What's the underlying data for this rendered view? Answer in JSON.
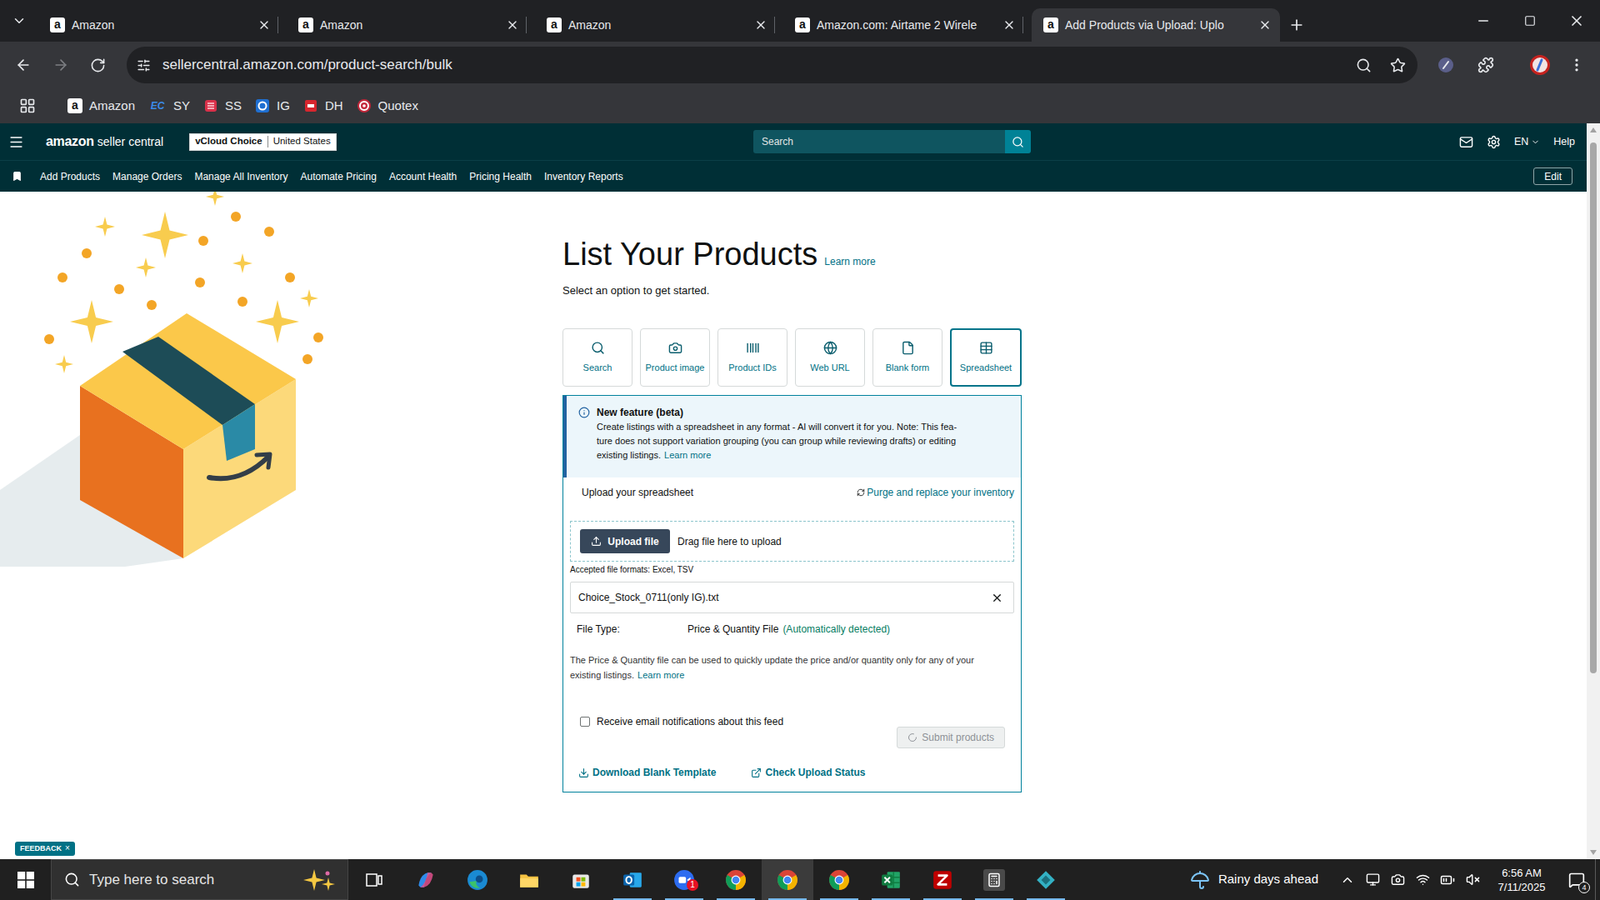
{
  "browser": {
    "tabs": [
      {
        "favicon": "a",
        "label": "Amazon",
        "selected": false
      },
      {
        "favicon": "a",
        "label": "Amazon",
        "selected": false
      },
      {
        "favicon": "a",
        "label": "Amazon",
        "selected": false
      },
      {
        "favicon": "a",
        "label": "Amazon.com: Airtame 2 Wirele",
        "selected": false
      },
      {
        "favicon": "a",
        "label": "Add Products via Upload: Uplo",
        "selected": true
      }
    ],
    "back_enabled": true,
    "forward_enabled": false,
    "url": "sellercentral.amazon.com/product-search/bulk",
    "bookmarks": [
      {
        "label": "Amazon",
        "kind": "amazon",
        "icon_text": "a"
      },
      {
        "label": "SY",
        "kind": "ec",
        "icon_text": "EC"
      },
      {
        "label": "SS",
        "kind": "ss"
      },
      {
        "label": "IG",
        "kind": "ig"
      },
      {
        "label": "DH",
        "kind": "dh"
      },
      {
        "label": "Quotex",
        "kind": "quotex"
      }
    ]
  },
  "header": {
    "brand": "amazon",
    "product": "seller central",
    "store": "vCloud Choice",
    "marketplace": "United States",
    "search_placeholder": "Search",
    "language": "EN",
    "help": "Help"
  },
  "nav": {
    "items": [
      "Add Products",
      "Manage Orders",
      "Manage All Inventory",
      "Automate Pricing",
      "Account Health",
      "Pricing Health",
      "Inventory Reports"
    ],
    "edit": "Edit"
  },
  "page": {
    "title": "List Your Products",
    "title_link": "Learn more",
    "subtitle": "Select an option to get started.",
    "options": [
      {
        "label": "Search",
        "kind": "search",
        "selected": false
      },
      {
        "label": "Product image",
        "kind": "image",
        "selected": false
      },
      {
        "label": "Product IDs",
        "kind": "ids",
        "selected": false
      },
      {
        "label": "Web URL",
        "kind": "url",
        "selected": false
      },
      {
        "label": "Blank form",
        "kind": "form",
        "selected": false
      },
      {
        "label": "Spreadsheet",
        "kind": "spreadsheet",
        "selected": true
      }
    ],
    "info": {
      "title": "New feature (beta)",
      "lines": [
        "Create listings with a spreadsheet in any format - AI will convert it for you. Note: This fea-",
        "ture does not support variation grouping (you can group while reviewing drafts) or editing",
        "existing listings."
      ],
      "link": "Learn more"
    },
    "upload": {
      "heading": "Upload your spreadsheet",
      "purge_link": "Purge and replace your inventory",
      "button": "Upload file",
      "drop_hint": "Drag file here to upload",
      "formats": "Accepted file formats: Excel, TSV",
      "file_name": "Choice_Stock_0711(only IG).txt",
      "file_type_label": "File Type:",
      "file_type_value": "Price & Quantity File",
      "file_type_note": "(Automatically detected)",
      "description": "The Price & Quantity file can be used to quickly update the price and/or quantity only for any of your existing listings.",
      "description_link": "Learn more",
      "email_checkbox": {
        "label": "Receive email notifications about this feed",
        "checked": false
      },
      "submit": {
        "label": "Submit products",
        "disabled": true,
        "loading": true
      },
      "links": [
        {
          "label": "Download Blank Template",
          "kind": "download"
        },
        {
          "label": "Check Upload Status",
          "kind": "external"
        }
      ]
    },
    "feedback": {
      "label": "FEEDBACK",
      "close": "×"
    }
  },
  "taskbar": {
    "search_placeholder": "Type here to search",
    "apps": [
      {
        "kind": "task-view",
        "running": false,
        "selected": false
      },
      {
        "kind": "copilot",
        "running": false,
        "selected": false
      },
      {
        "kind": "edge",
        "running": false,
        "selected": false
      },
      {
        "kind": "explorer",
        "running": false,
        "selected": false
      },
      {
        "kind": "store",
        "running": false,
        "selected": false
      },
      {
        "kind": "outlook",
        "running": true,
        "selected": false
      },
      {
        "kind": "zoom",
        "running": true,
        "selected": false,
        "badge": "1"
      },
      {
        "kind": "chrome",
        "running": true,
        "selected": false
      },
      {
        "kind": "chrome",
        "running": true,
        "selected": true
      },
      {
        "kind": "chrome",
        "running": true,
        "selected": false
      },
      {
        "kind": "excel",
        "running": true,
        "selected": false
      },
      {
        "kind": "filezilla",
        "running": true,
        "selected": false
      },
      {
        "kind": "calculator",
        "running": true,
        "selected": false
      },
      {
        "kind": "app",
        "running": true,
        "selected": false
      }
    ],
    "weather": "Rainy days ahead",
    "time": "6:56 AM",
    "date": "7/11/2025",
    "notifications": "4"
  }
}
